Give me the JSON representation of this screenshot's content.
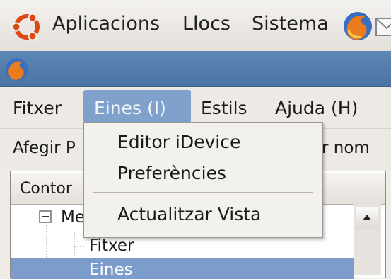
{
  "panel": {
    "items": [
      {
        "label": "Aplicacions"
      },
      {
        "label": "Llocs"
      },
      {
        "label": "Sistema"
      }
    ]
  },
  "menubar": {
    "items": [
      {
        "label": "Fitxer"
      },
      {
        "label": "Eines (I)"
      },
      {
        "label": "Estils"
      },
      {
        "label": "Ajuda (H)"
      }
    ]
  },
  "toolbar": {
    "left_label": "Afegir P",
    "right_label": "r nom"
  },
  "tree": {
    "header": "Contor",
    "root_label": "Me",
    "children": [
      {
        "label": "Fitxer"
      },
      {
        "label": "Eines"
      }
    ]
  },
  "dropdown": {
    "items": [
      {
        "label": "Editor iDevice"
      },
      {
        "label": "Preferències"
      },
      {
        "label": "Actualitzar Vista"
      }
    ]
  },
  "colors": {
    "titlebar": "#4a73a3",
    "menu_highlight": "#7fa1cc",
    "selection": "#7c9ccb"
  }
}
